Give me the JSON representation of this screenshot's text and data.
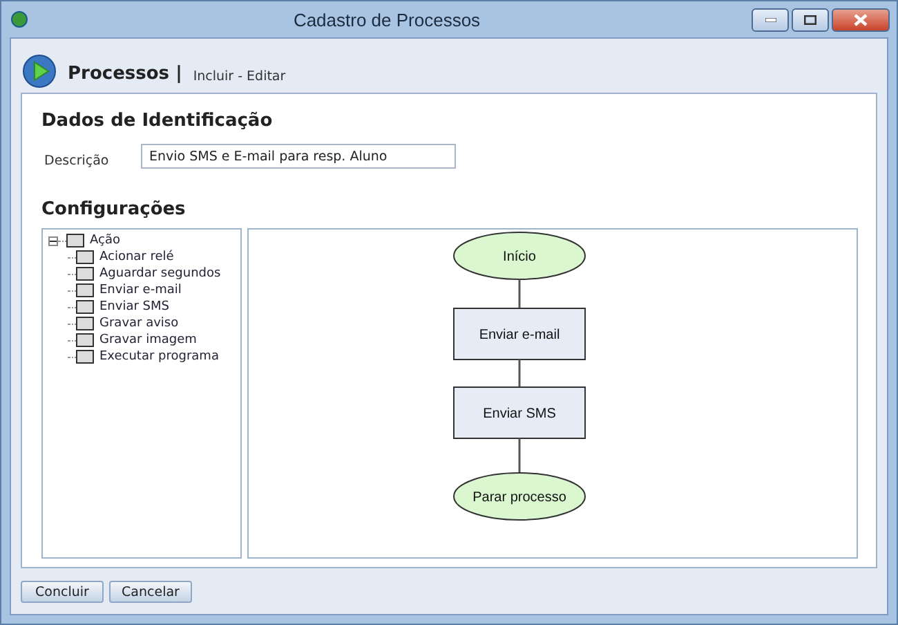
{
  "window": {
    "title": "Cadastro de Processos"
  },
  "header": {
    "title": "Processos |",
    "subtitle": "Incluir - Editar"
  },
  "identification": {
    "heading": "Dados de Identificação",
    "description_label": "Descrição",
    "description_value": "Envio SMS e E-mail para resp. Aluno"
  },
  "configuration": {
    "heading": "Configurações",
    "tree": [
      {
        "label": "Ação",
        "expanded": true,
        "children": [
          {
            "label": "Acionar relé"
          },
          {
            "label": "Aguardar segundos"
          },
          {
            "label": "Enviar e-mail"
          },
          {
            "label": "Enviar SMS"
          },
          {
            "label": "Gravar aviso"
          },
          {
            "label": "Gravar imagem"
          },
          {
            "label": "Executar programa"
          }
        ]
      }
    ],
    "flow": [
      {
        "kind": "start",
        "label": "Início"
      },
      {
        "kind": "step",
        "label": "Enviar e-mail"
      },
      {
        "kind": "step",
        "label": "Enviar SMS"
      },
      {
        "kind": "end",
        "label": "Parar processo"
      }
    ]
  },
  "buttons": [
    "Concluir",
    "Cancelar"
  ]
}
